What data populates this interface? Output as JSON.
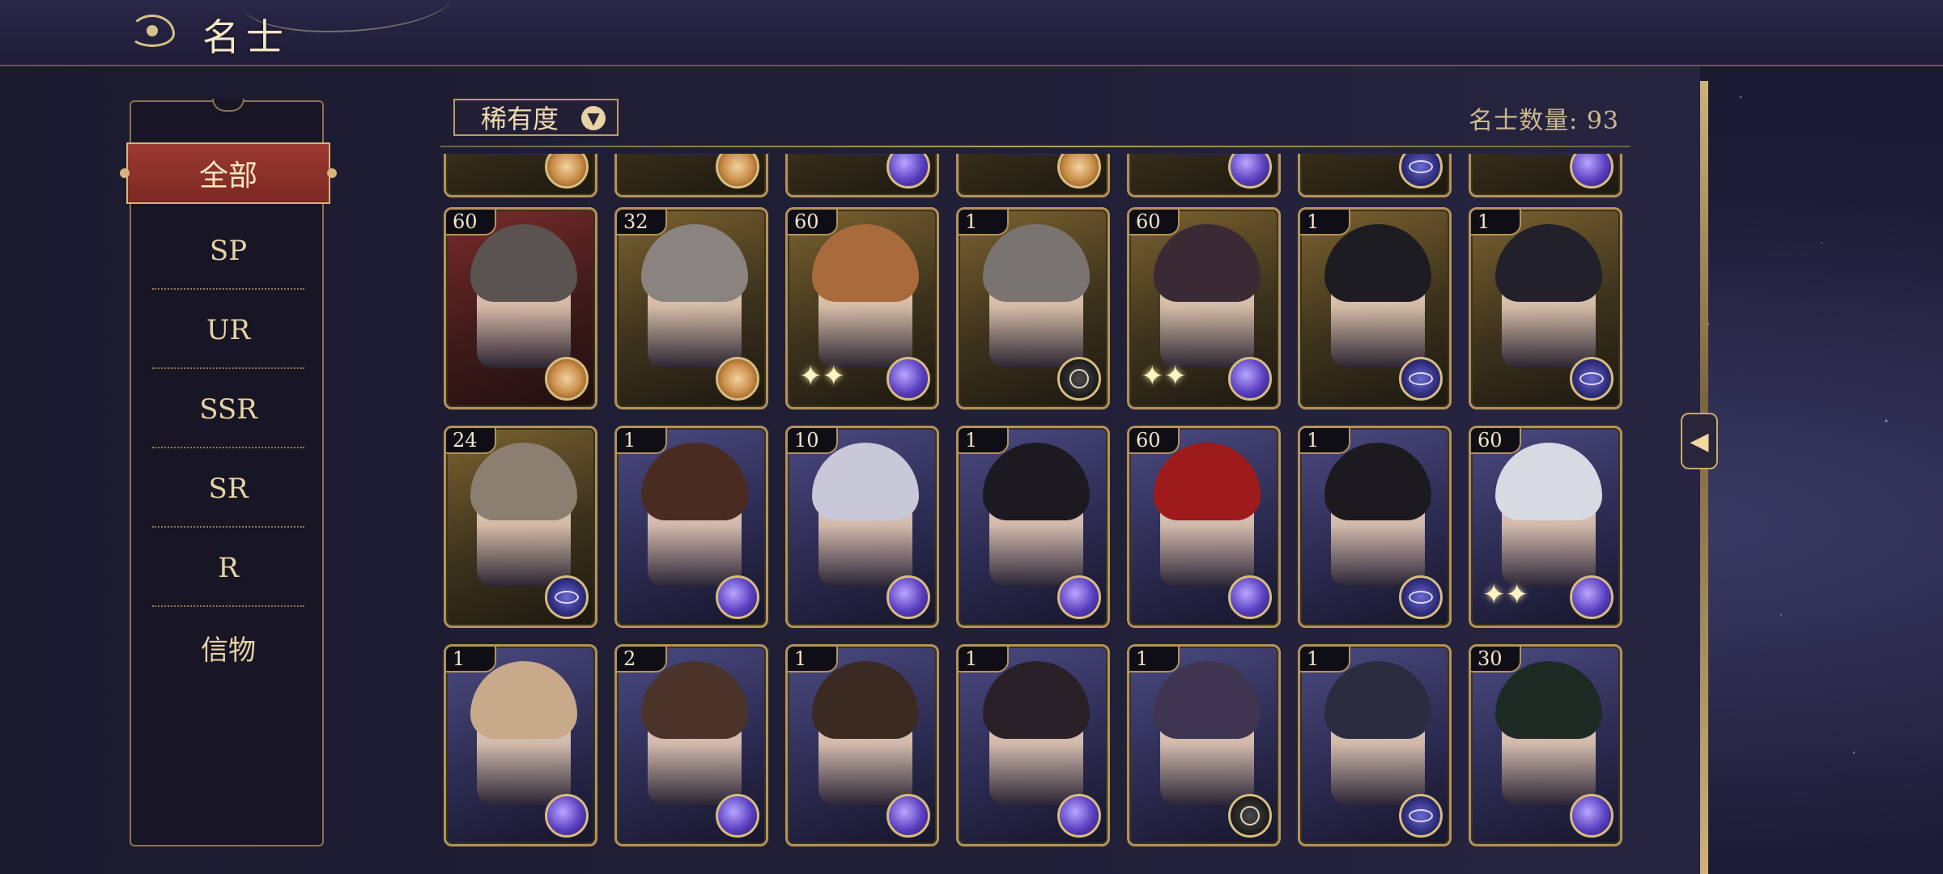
{
  "header": {
    "title": "名士"
  },
  "sidebar": {
    "items": [
      {
        "label": "全部",
        "active": true
      },
      {
        "label": "SP"
      },
      {
        "label": "UR"
      },
      {
        "label": "SSR"
      },
      {
        "label": "SR"
      },
      {
        "label": "R"
      },
      {
        "label": "信物"
      }
    ]
  },
  "toolbar": {
    "filter_label": "稀有度",
    "filter_icon": "chevron-down-icon",
    "count_text": "名士数量: 93"
  },
  "colors": {
    "accent_red": "#8f322c",
    "gold_border": "#b39359",
    "panel_bg": "#1f1d33"
  },
  "cards": [
    {
      "level": "",
      "frame": "gold",
      "badge": "sun",
      "partial": true
    },
    {
      "level": "",
      "frame": "gold",
      "badge": "sun",
      "partial": true
    },
    {
      "level": "",
      "frame": "gold",
      "badge": "orb",
      "partial": true
    },
    {
      "level": "",
      "frame": "gold",
      "badge": "sun",
      "partial": true
    },
    {
      "level": "",
      "frame": "gold",
      "badge": "orb",
      "partial": true
    },
    {
      "level": "",
      "frame": "gold",
      "badge": "ring",
      "partial": true
    },
    {
      "level": "",
      "frame": "gold",
      "badge": "orb",
      "partial": true
    },
    {
      "level": "60",
      "frame": "red",
      "badge": "sun"
    },
    {
      "level": "32",
      "frame": "gold",
      "badge": "sun"
    },
    {
      "level": "60",
      "frame": "gold",
      "badge": "orb"
    },
    {
      "level": "1",
      "frame": "gold",
      "badge": "dark"
    },
    {
      "level": "60",
      "frame": "gold",
      "badge": "orb"
    },
    {
      "level": "1",
      "frame": "gold",
      "badge": "ring"
    },
    {
      "level": "1",
      "frame": "gold",
      "badge": "ring"
    },
    {
      "level": "24",
      "frame": "gold",
      "badge": "ring"
    },
    {
      "level": "1",
      "frame": "purple",
      "badge": "orb"
    },
    {
      "level": "10",
      "frame": "purple",
      "badge": "orb"
    },
    {
      "level": "1",
      "frame": "purple",
      "badge": "orb"
    },
    {
      "level": "60",
      "frame": "purple",
      "badge": "orb"
    },
    {
      "level": "1",
      "frame": "purple",
      "badge": "ring"
    },
    {
      "level": "60",
      "frame": "purple",
      "badge": "orb"
    },
    {
      "level": "1",
      "frame": "purple",
      "badge": "orb"
    },
    {
      "level": "2",
      "frame": "purple",
      "badge": "orb"
    },
    {
      "level": "1",
      "frame": "purple",
      "badge": "orb"
    },
    {
      "level": "1",
      "frame": "purple",
      "badge": "orb"
    },
    {
      "level": "1",
      "frame": "purple",
      "badge": "dark"
    },
    {
      "level": "1",
      "frame": "purple",
      "badge": "ring"
    },
    {
      "level": "30",
      "frame": "purple",
      "badge": "orb"
    }
  ]
}
